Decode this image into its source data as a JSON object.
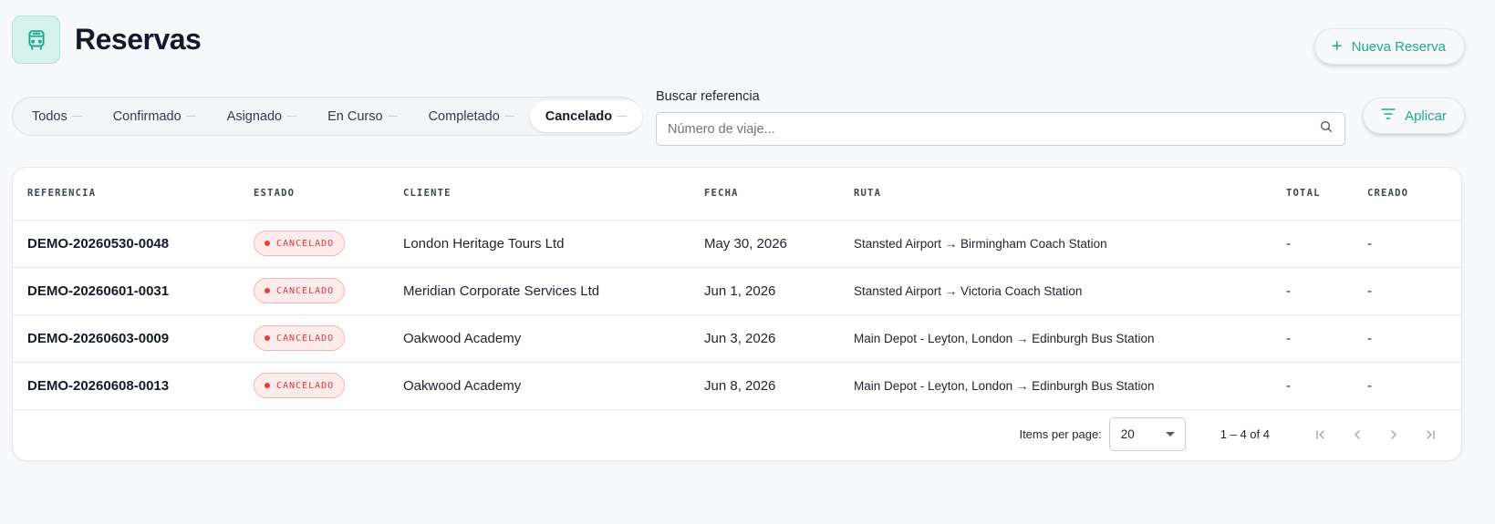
{
  "header": {
    "title": "Reservas",
    "new_button_label": "Nueva Reserva"
  },
  "tabs": [
    {
      "label": "Todos",
      "active": false
    },
    {
      "label": "Confirmado",
      "active": false
    },
    {
      "label": "Asignado",
      "active": false
    },
    {
      "label": "En Curso",
      "active": false
    },
    {
      "label": "Completado",
      "active": false
    },
    {
      "label": "Cancelado",
      "active": true
    }
  ],
  "search": {
    "label": "Buscar referencia",
    "placeholder": "Número de viaje...",
    "value": ""
  },
  "apply_button_label": "Aplicar",
  "table": {
    "columns": [
      "REFERENCIA",
      "ESTADO",
      "CLIENTE",
      "FECHA",
      "RUTA",
      "TOTAL",
      "CREADO"
    ],
    "rows": [
      {
        "ref": "DEMO-20260530-0048",
        "status": "CANCELADO",
        "client": "London Heritage Tours Ltd",
        "date": "May 30, 2026",
        "route": "Stansted Airport → Birmingham Coach Station",
        "total": "-",
        "created": "-"
      },
      {
        "ref": "DEMO-20260601-0031",
        "status": "CANCELADO",
        "client": "Meridian Corporate Services Ltd",
        "date": "Jun 1, 2026",
        "route": "Stansted Airport → Victoria Coach Station",
        "total": "-",
        "created": "-"
      },
      {
        "ref": "DEMO-20260603-0009",
        "status": "CANCELADO",
        "client": "Oakwood Academy",
        "date": "Jun 3, 2026",
        "route": "Main Depot - Leyton, London → Edinburgh Bus Station",
        "total": "-",
        "created": "-"
      },
      {
        "ref": "DEMO-20260608-0013",
        "status": "CANCELADO",
        "client": "Oakwood Academy",
        "date": "Jun 8, 2026",
        "route": "Main Depot - Leyton, London → Edinburgh Bus Station",
        "total": "-",
        "created": "-"
      }
    ]
  },
  "paginator": {
    "items_per_page_label": "Items per page:",
    "items_per_page": "20",
    "range": "1 – 4 of 4"
  },
  "colors": {
    "accent": "#20a98d",
    "cancel": "#d63a3a",
    "cancel_bg": "#fdeaea"
  },
  "icons": {
    "logo": "bus-icon",
    "new": "plus-icon",
    "search": "search-icon",
    "apply": "filter-icon",
    "first": "first-page-icon",
    "prev": "chevron-left-icon",
    "next": "chevron-right-icon",
    "last": "last-page-icon"
  }
}
